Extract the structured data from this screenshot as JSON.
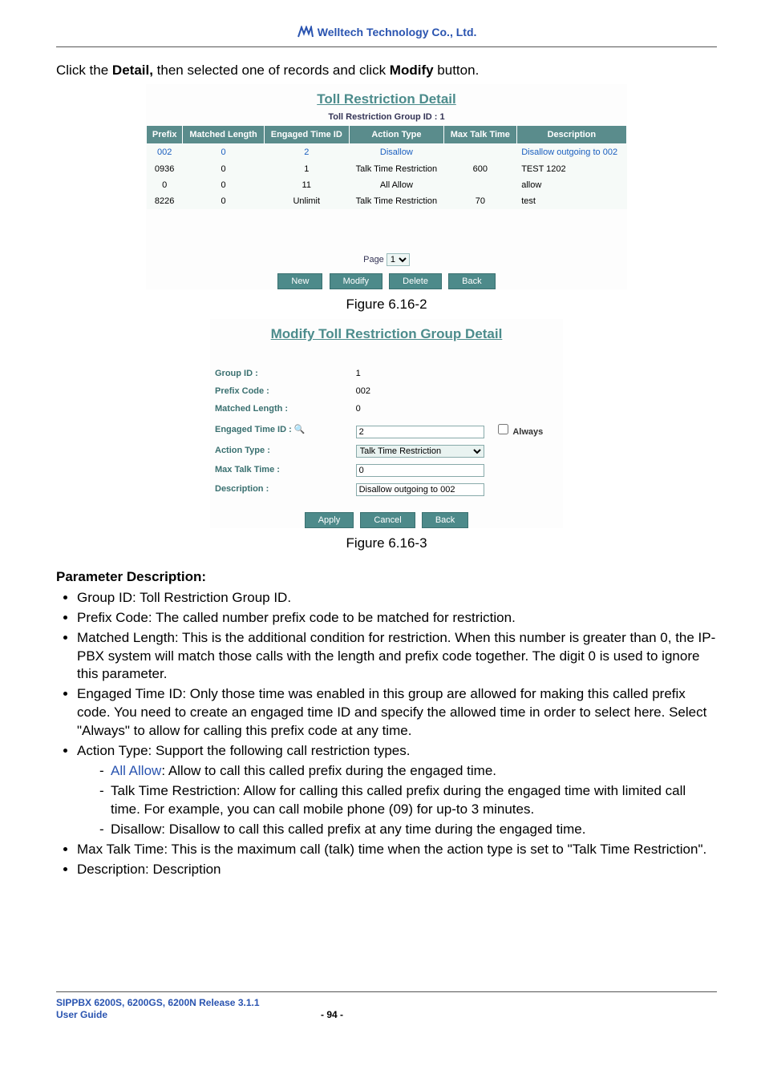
{
  "header": {
    "brand": "Welltech Technology Co., Ltd."
  },
  "intro": {
    "pre": "Click the ",
    "b1": "Detail,",
    "mid": " then selected one of records and click ",
    "b2": "Modify",
    "post": " button."
  },
  "fig1": {
    "title": "Toll Restriction Detail",
    "sub": "Toll Restriction Group ID : 1",
    "headers": [
      "Prefix",
      "Matched Length",
      "Engaged Time ID",
      "Action Type",
      "Max Talk Time",
      "Description"
    ],
    "rows": [
      {
        "sel": true,
        "c": [
          "002",
          "0",
          "2",
          "Disallow",
          "",
          "Disallow outgoing to 002"
        ]
      },
      {
        "sel": false,
        "c": [
          "0936",
          "0",
          "1",
          "Talk Time Restriction",
          "600",
          "TEST 1202"
        ]
      },
      {
        "sel": false,
        "c": [
          "0",
          "0",
          "11",
          "All Allow",
          "",
          "allow"
        ]
      },
      {
        "sel": false,
        "c": [
          "8226",
          "0",
          "Unlimit",
          "Talk Time Restriction",
          "70",
          "test"
        ]
      }
    ],
    "page_label": "Page",
    "page_value": "1",
    "buttons": {
      "new": "New",
      "modify": "Modify",
      "delete": "Delete",
      "back": "Back"
    },
    "caption": "Figure 6.16-2"
  },
  "fig2": {
    "title": "Modify Toll Restriction Group Detail",
    "fields": {
      "group_id_lbl": "Group ID :",
      "group_id_val": "1",
      "prefix_lbl": "Prefix Code :",
      "prefix_val": "002",
      "mlen_lbl": "Matched Length :",
      "mlen_val": "0",
      "eng_lbl": "Engaged Time ID :",
      "eng_val": "2",
      "eng_chk": "Always",
      "act_lbl": "Action Type :",
      "act_val": "Talk Time Restriction",
      "max_lbl": "Max Talk Time :",
      "max_val": "0",
      "desc_lbl": "Description :",
      "desc_val": "Disallow outgoing to 002"
    },
    "buttons": {
      "apply": "Apply",
      "cancel": "Cancel",
      "back": "Back"
    },
    "caption": "Figure 6.16-3"
  },
  "param": {
    "heading": "Parameter Description:",
    "items": [
      "Group ID: Toll Restriction Group ID.",
      "Prefix Code: The called number prefix code to be matched for restriction.",
      "Matched Length: This is the additional condition for restriction. When this number is greater than 0, the IP-PBX system will match those calls with the length and prefix code together. The digit 0 is used to ignore this parameter.",
      "Engaged Time ID: Only those time was enabled in this group are allowed for making this called prefix code. You need to create an engaged time ID and specify the allowed time in order to select here. Select \"Always\" to allow for calling this prefix code at any time.",
      "Action Type: Support the following call restriction types.",
      "Max Talk Time: This is the maximum call (talk) time when the action type is set to \"Talk Time Restriction\".",
      "Description: Description"
    ],
    "action_sub": [
      {
        "pre": "",
        "link": "All Allow",
        "post": ": Allow to call this called prefix during the engaged time."
      },
      {
        "pre": "Talk Time Restriction: Allow for calling this called prefix during the engaged time with limited call time. For example, you can call mobile phone (09) for up-to 3 minutes.",
        "link": "",
        "post": ""
      },
      {
        "pre": "Disallow: Disallow to call this called prefix at any time during the engaged time.",
        "link": "",
        "post": ""
      }
    ]
  },
  "footer": {
    "line1": "SIPPBX 6200S, 6200GS, 6200N Release 3.1.1",
    "line2": "User Guide",
    "page": "- 94 -"
  }
}
